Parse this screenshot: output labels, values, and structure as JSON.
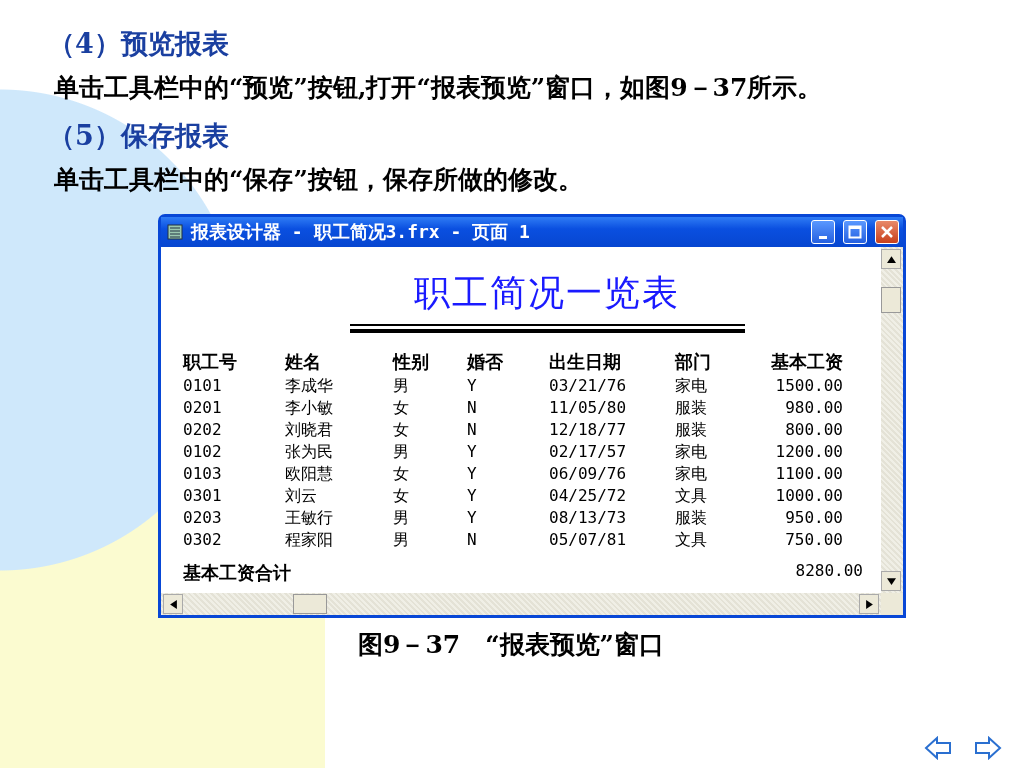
{
  "sections": [
    {
      "heading": "（4）预览报表",
      "paragraph": "单击工具栏中的“预览”按钮,打开“报表预览”窗口，如图9－37所示。"
    },
    {
      "heading": "（5）保存报表",
      "paragraph": "单击工具栏中的“保存”按钮，保存所做的修改。"
    }
  ],
  "window": {
    "title": "报表设计器 - 职工简况3.frx - 页面 1",
    "report": {
      "title": "职工简况一览表",
      "columns": [
        "职工号",
        "姓名",
        "性别",
        "婚否",
        "出生日期",
        "部门",
        "基本工资"
      ],
      "rows": [
        [
          "0101",
          "李成华",
          "男",
          "Y",
          "03/21/76",
          "家电",
          "1500.00"
        ],
        [
          "0201",
          "李小敏",
          "女",
          "N",
          "11/05/80",
          "服装",
          "980.00"
        ],
        [
          "0202",
          "刘晓君",
          "女",
          "N",
          "12/18/77",
          "服装",
          "800.00"
        ],
        [
          "0102",
          "张为民",
          "男",
          "Y",
          "02/17/57",
          "家电",
          "1200.00"
        ],
        [
          "0103",
          "欧阳慧",
          "女",
          "Y",
          "06/09/76",
          "家电",
          "1100.00"
        ],
        [
          "0301",
          "刘云",
          "女",
          "Y",
          "04/25/72",
          "文具",
          "1000.00"
        ],
        [
          "0203",
          "王敏行",
          "男",
          "Y",
          "08/13/73",
          "服装",
          "950.00"
        ],
        [
          "0302",
          "程家阳",
          "男",
          "N",
          "05/07/81",
          "文具",
          "750.00"
        ]
      ],
      "total_label": "基本工资合计",
      "total": "8280.00"
    }
  },
  "caption": "图9－37　“报表预览”窗口"
}
